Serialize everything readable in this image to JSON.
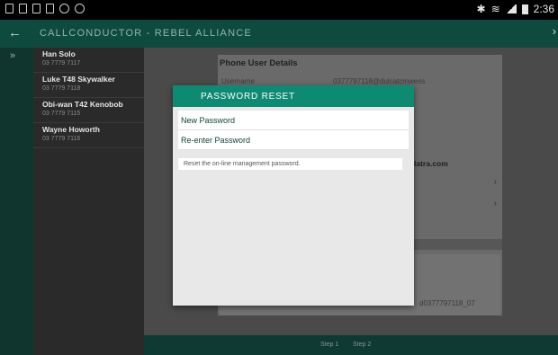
{
  "status_bar": {
    "time": "2:36"
  },
  "app_bar": {
    "title": "CALLCONDUCTOR  -  REBEL ALLIANCE"
  },
  "contacts": [
    {
      "name": "Han Solo",
      "number": "03 7779 7117"
    },
    {
      "name": "Luke T48 Skywalker",
      "number": "03 7779 7118"
    },
    {
      "name": "Obi-wan T42 Kenobob",
      "number": "03 7779 7115"
    },
    {
      "name": "Wayne Howorth",
      "number": "03 7779 7116"
    }
  ],
  "background_panel": {
    "title": "Phone User Details",
    "username_label": "Username",
    "username_value": "0377797118@dulcatcmwess",
    "domain_fragment": "latra.com",
    "footer_value": "d0377797118_07"
  },
  "footer": {
    "step1": "Step 1",
    "step2": "Step 2"
  },
  "modal": {
    "title": "PASSWORD RESET",
    "new_password_placeholder": "New Password",
    "reenter_password_placeholder": "Re-enter Password",
    "hint": "Reset the on-line management password."
  }
}
